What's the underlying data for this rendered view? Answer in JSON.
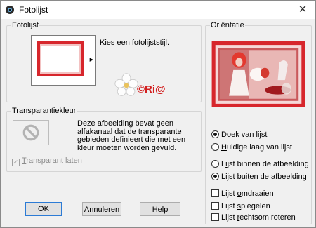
{
  "window": {
    "title": "Fotolijst",
    "close_glyph": "✕"
  },
  "frame_group": {
    "legend": "Fotolijst",
    "style_prompt": "Kies een fotolijststijl.",
    "watermark_text": "©Ri@"
  },
  "transparency_group": {
    "legend": "Transparantiekleur",
    "description": "Deze afbeelding bevat geen alfakanaal dat de transparante gebieden definieert die met een kleur moeten worden gevuld.",
    "transparent_checkbox": {
      "prefix": "",
      "mnemonic": "T",
      "rest": "ransparant laten",
      "checked": true,
      "enabled": false
    }
  },
  "orientation_group": {
    "legend": "Oriëntatie",
    "apply_to": [
      {
        "mnemonic": "D",
        "rest": "oek van lijst",
        "selected": true
      },
      {
        "mnemonic": "H",
        "rest": "uidige laag van lijst",
        "selected": false
      }
    ],
    "placement": [
      {
        "prefix": "L",
        "mnemonic": "i",
        "rest": "jst binnen de afbeelding",
        "selected": false
      },
      {
        "prefix": "Lijst ",
        "mnemonic": "b",
        "rest": "uiten de afbeelding",
        "selected": true
      }
    ],
    "options": [
      {
        "prefix": "Lijst ",
        "mnemonic": "o",
        "rest": "mdraaien",
        "checked": false
      },
      {
        "prefix": "Lijst ",
        "mnemonic": "s",
        "rest": "piegelen",
        "checked": false
      },
      {
        "prefix": "Lijst ",
        "mnemonic": "r",
        "rest": "echtsom roteren",
        "checked": false
      }
    ]
  },
  "buttons": {
    "ok": "OK",
    "cancel": "Annuleren",
    "help": "Help"
  },
  "colors": {
    "frame_red": "#d7262c",
    "focus_blue": "#2c7bd5",
    "preview_bg": "#c9595c"
  },
  "icons": [
    "app-icon",
    "close-icon",
    "frame-style-dropdown-icon",
    "flower-icon",
    "no-transparency-icon"
  ]
}
